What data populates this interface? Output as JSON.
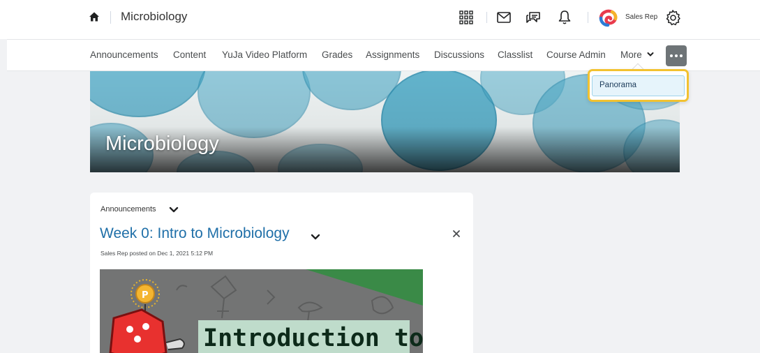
{
  "topbar": {
    "course_title": "Microbiology",
    "user_name": "Sales Rep",
    "icons": [
      "home-icon",
      "waffle-grid-icon",
      "mail-icon",
      "chat-icon",
      "bell-icon",
      "settings-icon"
    ]
  },
  "nav": {
    "items": [
      {
        "label": "Announcements"
      },
      {
        "label": "Content"
      },
      {
        "label": "YuJa Video Platform"
      },
      {
        "label": "Grades"
      },
      {
        "label": "Assignments"
      },
      {
        "label": "Discussions"
      },
      {
        "label": "Classlist"
      },
      {
        "label": "Course Admin"
      },
      {
        "label": "More"
      }
    ],
    "dropdown": {
      "items": [
        {
          "label": "Panorama"
        }
      ]
    }
  },
  "banner": {
    "title": "Microbiology"
  },
  "widget": {
    "title": "Announcements",
    "post_title": "Week 0: Intro to Microbiology",
    "post_meta": "Sales Rep posted on Dec 1, 2021 5:12 PM",
    "thumbnail_text": "Introduction to"
  },
  "colors": {
    "link": "#1f6fa8",
    "focus_ring": "#f2c230",
    "more_button": "#6e7477",
    "banner_watercolor": "#4aa8c6"
  }
}
